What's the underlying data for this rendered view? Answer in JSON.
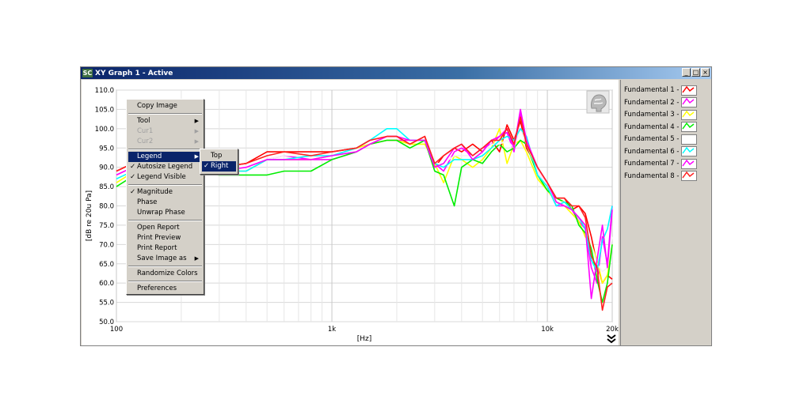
{
  "window": {
    "title": "XY Graph 1 - Active",
    "app_icon_text": "SC",
    "buttons": [
      "_",
      "□",
      "×"
    ]
  },
  "chart_data": {
    "type": "line",
    "xscale": "log",
    "xlim": [
      100,
      20000
    ],
    "ylim": [
      50,
      110
    ],
    "xlabel": "[Hz]",
    "ylabel": "[dB re 20u Pa]",
    "x_ticks": [
      "100",
      "1k",
      "10k",
      "20k"
    ],
    "y_ticks": [
      "110.0",
      "105.0",
      "100.0",
      "95.0",
      "90.0",
      "85.0",
      "80.0",
      "75.0",
      "70.0",
      "65.0",
      "60.0",
      "55.0",
      "50.0"
    ],
    "grid": true,
    "legend_placement": "right",
    "series": [
      {
        "name": "Fundamental 1 - p",
        "color": "#ff0000",
        "x": [
          100,
          130,
          200,
          300,
          400,
          500,
          600,
          800,
          1000,
          1300,
          1500,
          1800,
          2000,
          2300,
          2700,
          3000,
          3300,
          3700,
          4000,
          4500,
          5000,
          5500,
          6000,
          6500,
          7000,
          7500,
          8000,
          9000,
          10000,
          11000,
          12000,
          13000,
          14000,
          15000,
          16000,
          17000,
          18000,
          19000,
          20000
        ],
        "y": [
          89,
          92,
          90,
          90,
          91,
          94,
          94,
          94,
          94,
          95,
          97,
          98,
          98,
          96,
          98,
          90,
          93,
          95,
          94,
          96,
          94,
          97,
          94,
          101,
          97,
          102,
          95,
          90,
          86,
          82,
          82,
          79,
          80,
          78,
          72,
          65,
          60,
          62,
          61
        ]
      },
      {
        "name": "Fundamental 2 - p",
        "color": "#ff00ff",
        "x": [
          100,
          130,
          200,
          300,
          400,
          500,
          600,
          800,
          1000,
          1300,
          1500,
          1800,
          2000,
          2300,
          2700,
          3000,
          3300,
          3700,
          4000,
          4500,
          5000,
          5500,
          6000,
          6500,
          7000,
          7500,
          8000,
          9000,
          10000,
          11000,
          12000,
          13000,
          14000,
          15000,
          16000,
          17000,
          18000,
          19000,
          20000
        ],
        "y": [
          88,
          91,
          90,
          89,
          89,
          92,
          93,
          92,
          92,
          94,
          96,
          97,
          97,
          97,
          97,
          91,
          89,
          94,
          95,
          93,
          95,
          96,
          98,
          99,
          94,
          104,
          96,
          89,
          85,
          80,
          80,
          79,
          76,
          74,
          64,
          60,
          72,
          65,
          80
        ]
      },
      {
        "name": "Fundamental 3 - p",
        "color": "#ffff00",
        "x": [
          100,
          130,
          200,
          300,
          400,
          500,
          600,
          800,
          1000,
          1300,
          1500,
          1800,
          2000,
          2300,
          2700,
          3000,
          3300,
          3700,
          4000,
          4500,
          5000,
          5500,
          6000,
          6500,
          7000,
          7500,
          8000,
          9000,
          10000,
          11000,
          12000,
          13000,
          14000,
          15000,
          16000,
          17000,
          18000,
          19000,
          20000
        ],
        "y": [
          86,
          90,
          90,
          89,
          89,
          92,
          92,
          92,
          93,
          95,
          96,
          97,
          97,
          96,
          96,
          91,
          86,
          93,
          92,
          90,
          92,
          95,
          100,
          91,
          96,
          97,
          94,
          87,
          84,
          81,
          80,
          78,
          76,
          72,
          70,
          66,
          60,
          62,
          70
        ]
      },
      {
        "name": "Fundamental 4 - p",
        "color": "#00ee00",
        "x": [
          100,
          130,
          200,
          300,
          400,
          500,
          600,
          800,
          1000,
          1300,
          1500,
          1800,
          2000,
          2300,
          2700,
          3000,
          3300,
          3700,
          4000,
          4500,
          5000,
          5500,
          6000,
          6500,
          7000,
          7500,
          8000,
          9000,
          10000,
          11000,
          12000,
          13000,
          14000,
          15000,
          16000,
          17000,
          18000,
          19000,
          20000
        ],
        "y": [
          85,
          89,
          89,
          88,
          88,
          88,
          89,
          89,
          92,
          94,
          96,
          97,
          97,
          95,
          97,
          89,
          88,
          80,
          90,
          92,
          91,
          94,
          96,
          94,
          95,
          97,
          96,
          88,
          84,
          82,
          81,
          80,
          75,
          73,
          69,
          61,
          55,
          60,
          70
        ]
      },
      {
        "name": "Fundamental 5 - p",
        "color": "#ffffff",
        "x": [
          100,
          130,
          200,
          300,
          400,
          500,
          600,
          800,
          1000,
          1300,
          1500,
          1800,
          2000,
          2300,
          2700,
          3000,
          3300,
          3700,
          4000,
          4500,
          5000,
          5500,
          6000,
          6500,
          7000,
          7500,
          8000,
          9000,
          10000,
          11000,
          12000,
          13000,
          14000,
          15000,
          16000,
          17000,
          18000,
          19000,
          20000
        ],
        "y": [
          88,
          91,
          90,
          90,
          90,
          92,
          93,
          93,
          93,
          95,
          97,
          98,
          98,
          97,
          97,
          91,
          91,
          93,
          93,
          93,
          94,
          96,
          96,
          97,
          95,
          100,
          96,
          89,
          85,
          81,
          81,
          79,
          77,
          75,
          70,
          65,
          63,
          64,
          72
        ]
      },
      {
        "name": "Fundamental 6 - p",
        "color": "#00ffff",
        "x": [
          100,
          130,
          200,
          300,
          400,
          500,
          600,
          800,
          1000,
          1300,
          1500,
          1800,
          2000,
          2300,
          2700,
          3000,
          3300,
          3700,
          4000,
          4500,
          5000,
          5500,
          6000,
          6500,
          7000,
          7500,
          8000,
          9000,
          10000,
          11000,
          12000,
          13000,
          14000,
          15000,
          16000,
          17000,
          18000,
          19000,
          20000
        ],
        "y": [
          87,
          90,
          89,
          89,
          89,
          92,
          92,
          93,
          93,
          95,
          97,
          100,
          100,
          97,
          97,
          91,
          90,
          92,
          92,
          92,
          93,
          95,
          97,
          98,
          97,
          100,
          98,
          88,
          85,
          80,
          81,
          79,
          77,
          74,
          66,
          63,
          71,
          74,
          80
        ]
      },
      {
        "name": "Fundamental 7 - p",
        "color": "#ff00ff",
        "x": [
          100,
          130,
          200,
          300,
          400,
          500,
          600,
          800,
          1000,
          1300,
          1500,
          1800,
          2000,
          2300,
          2700,
          3000,
          3300,
          3700,
          4000,
          4500,
          5000,
          5500,
          6000,
          6500,
          7000,
          7500,
          8000,
          9000,
          10000,
          11000,
          12000,
          13000,
          14000,
          15000,
          16000,
          17000,
          18000,
          19000,
          20000
        ],
        "y": [
          88,
          91,
          90,
          89,
          90,
          92,
          92,
          92,
          93,
          94,
          96,
          98,
          98,
          97,
          97,
          90,
          91,
          95,
          96,
          92,
          94,
          97,
          98,
          100,
          95,
          105,
          97,
          90,
          86,
          81,
          80,
          79,
          77,
          75,
          56,
          66,
          75,
          64,
          79
        ]
      },
      {
        "name": "Fundamental 8 - p",
        "color": "#ff2020",
        "x": [
          100,
          130,
          200,
          300,
          400,
          500,
          600,
          800,
          1000,
          1300,
          1500,
          1800,
          2000,
          2300,
          2700,
          3000,
          3300,
          3700,
          4000,
          4500,
          5000,
          5500,
          6000,
          6500,
          7000,
          7500,
          8000,
          9000,
          10000,
          11000,
          12000,
          13000,
          14000,
          15000,
          16000,
          17000,
          18000,
          19000,
          20000
        ],
        "y": [
          89,
          92,
          90,
          90,
          91,
          93,
          94,
          93,
          94,
          95,
          97,
          98,
          98,
          96,
          98,
          91,
          93,
          95,
          96,
          93,
          95,
          97,
          97,
          100,
          96,
          103,
          96,
          90,
          86,
          82,
          82,
          80,
          80,
          77,
          67,
          64,
          53,
          59,
          60
        ]
      }
    ]
  },
  "context_menu": {
    "items": [
      {
        "label": "Copy Image",
        "check": "",
        "arrow": "",
        "disabled": false,
        "highlight": false
      },
      {
        "sep": true
      },
      {
        "label": "Tool",
        "check": "",
        "arrow": "▶",
        "disabled": false,
        "highlight": false
      },
      {
        "label": "Cur1",
        "check": "",
        "arrow": "▶",
        "disabled": true,
        "highlight": false
      },
      {
        "label": "Cur2",
        "check": "",
        "arrow": "▶",
        "disabled": true,
        "highlight": false
      },
      {
        "sep": true
      },
      {
        "label": "Legend",
        "check": "",
        "arrow": "▶",
        "disabled": false,
        "highlight": true
      },
      {
        "label": "Autosize Legend",
        "check": "✓",
        "arrow": "",
        "disabled": false,
        "highlight": false
      },
      {
        "label": "Legend Visible",
        "check": "✓",
        "arrow": "",
        "disabled": false,
        "highlight": false
      },
      {
        "sep": true
      },
      {
        "label": "Magnitude",
        "check": "✓",
        "arrow": "",
        "disabled": false,
        "highlight": false
      },
      {
        "label": "Phase",
        "check": "",
        "arrow": "",
        "disabled": false,
        "highlight": false
      },
      {
        "label": "Unwrap Phase",
        "check": "",
        "arrow": "",
        "disabled": false,
        "highlight": false
      },
      {
        "sep": true
      },
      {
        "label": "Open Report",
        "check": "",
        "arrow": "",
        "disabled": false,
        "highlight": false
      },
      {
        "label": "Print Preview",
        "check": "",
        "arrow": "",
        "disabled": false,
        "highlight": false
      },
      {
        "label": "Print Report",
        "check": "",
        "arrow": "",
        "disabled": false,
        "highlight": false
      },
      {
        "label": "Save Image as",
        "check": "",
        "arrow": "▶",
        "disabled": false,
        "highlight": false
      },
      {
        "sep": true
      },
      {
        "label": "Randomize Colors",
        "check": "",
        "arrow": "",
        "disabled": false,
        "highlight": false
      },
      {
        "sep": true
      },
      {
        "label": "Preferences",
        "check": "",
        "arrow": "",
        "disabled": false,
        "highlight": false
      }
    ]
  },
  "submenu": {
    "items": [
      {
        "label": "Top",
        "check": "",
        "highlight": false
      },
      {
        "label": "Right",
        "check": "✓",
        "highlight": true
      }
    ]
  },
  "scroll_icon": "double-chevron-down"
}
